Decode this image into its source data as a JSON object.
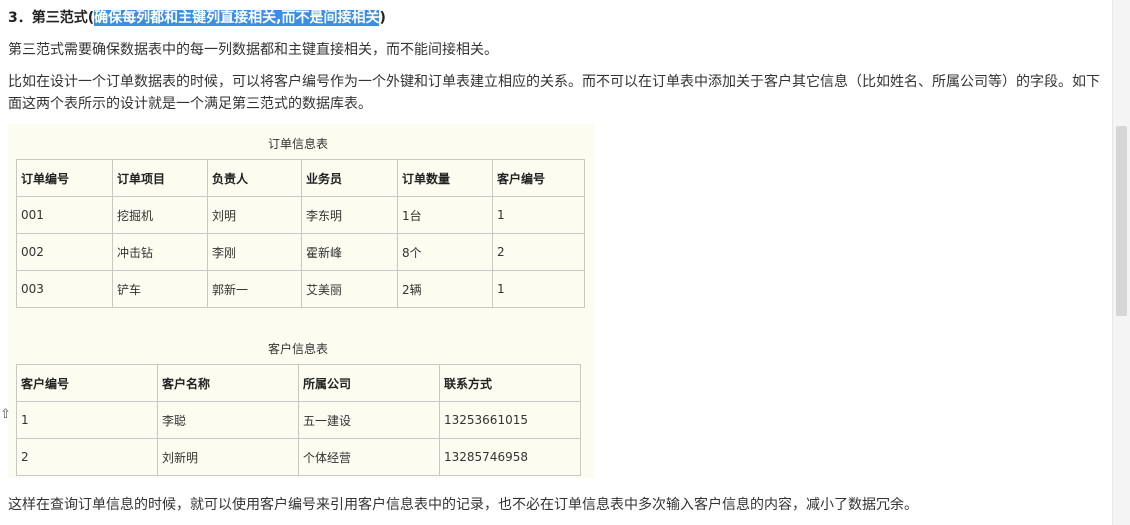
{
  "heading": {
    "prefix": "3．第三范式(",
    "selected": "确保每列都和主键列直接相关,而不是间接相关",
    "suffix": ")"
  },
  "paragraphs": {
    "p1": "第三范式需要确保数据表中的每一列数据都和主键直接相关，而不能间接相关。",
    "p2": "比如在设计一个订单数据表的时候，可以将客户编号作为一个外键和订单表建立相应的关系。而不可以在订单表中添加关于客户其它信息（比如姓名、所属公司等）的字段。如下面这两个表所示的设计就是一个满足第三范式的数据库表。",
    "p3": "这样在查询订单信息的时候，就可以使用客户编号来引用客户信息表中的记录，也不必在订单信息表中多次输入客户信息的内容，减小了数据冗余。"
  },
  "order_table": {
    "caption": "订单信息表",
    "headers": [
      "订单编号",
      "订单项目",
      "负责人",
      "业务员",
      "订单数量",
      "客户编号"
    ],
    "rows": [
      [
        "001",
        "挖掘机",
        "刘明",
        "李东明",
        "1台",
        "1"
      ],
      [
        "002",
        "冲击钻",
        "李刚",
        "霍新峰",
        "8个",
        "2"
      ],
      [
        "003",
        "铲车",
        "郭新一",
        "艾美丽",
        "2辆",
        "1"
      ]
    ]
  },
  "customer_table": {
    "caption": "客户信息表",
    "headers": [
      "客户编号",
      "客户名称",
      "所属公司",
      "联系方式"
    ],
    "rows": [
      [
        "1",
        "李聪",
        "五一建设",
        "13253661015"
      ],
      [
        "2",
        "刘新明",
        "个体经营",
        "13285746958"
      ]
    ]
  },
  "colors": {
    "selection": "#3a8ee6",
    "table_panel": "#fcfcf0",
    "border": "#c8c8c8"
  }
}
